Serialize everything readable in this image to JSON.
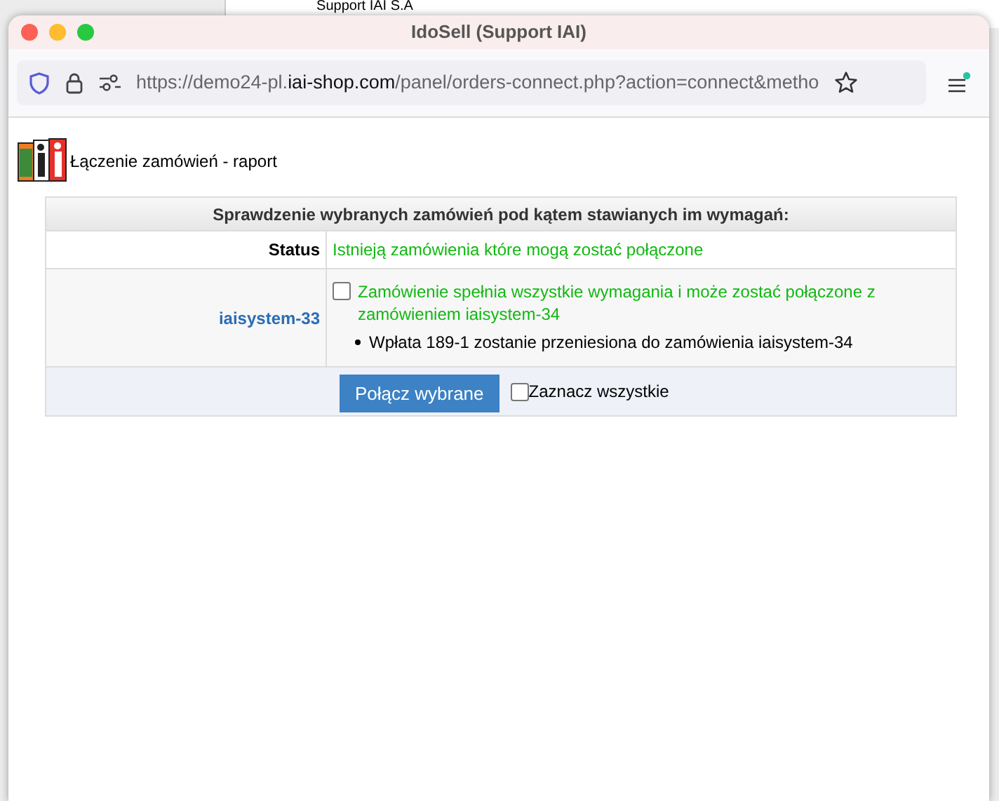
{
  "background_page": {
    "title": "Support IAI S.A"
  },
  "window": {
    "title": "IdoSell (Support IAI)"
  },
  "address_bar": {
    "url_prefix": "https://demo24-pl.",
    "url_domain": "iai-shop.com",
    "url_path": "/panel/orders-connect.php?action=connect&metho",
    "menu_badge": true
  },
  "page": {
    "heading": "Łączenie zamówień - raport",
    "table": {
      "header": "Sprawdzenie wybranych zamówień pod kątem stawianych im wymagań:",
      "status": {
        "label": "Status",
        "value": "Istnieją zamówienia które mogą zostać połączone"
      },
      "orders": [
        {
          "order": "iaisystem-33",
          "checked": false,
          "message": "Zamówienie spełnia wszystkie wymagania i może zostać połączone z zamówieniem iaisystem-34",
          "notes": [
            "Wpłata 189-1 zostanie przeniesiona do zamówienia iaisystem-34"
          ]
        }
      ],
      "footer": {
        "button": "Połącz wybrane",
        "select_all": {
          "label": "Zaznacz wszystkie",
          "checked": false
        }
      }
    }
  }
}
